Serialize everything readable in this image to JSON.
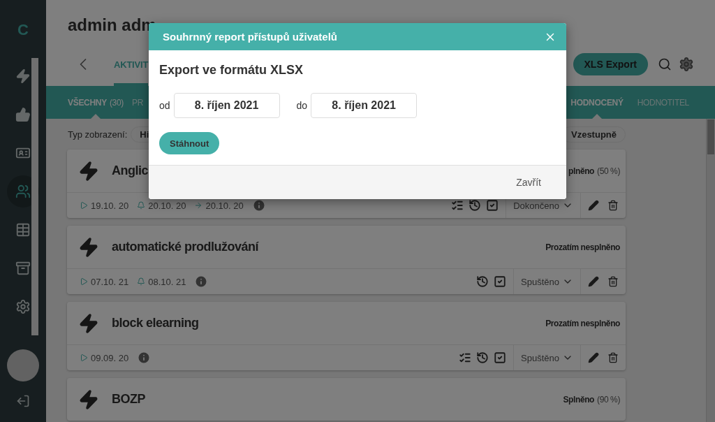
{
  "sidebar": {
    "logo": "C",
    "items": [
      {
        "kind": "bolt",
        "selected": false
      },
      {
        "kind": "thumb",
        "selected": false
      },
      {
        "kind": "card",
        "selected": false
      },
      {
        "kind": "users",
        "selected": true
      },
      {
        "kind": "table",
        "selected": false
      },
      {
        "kind": "archive",
        "selected": false
      },
      {
        "kind": "settings",
        "selected": false
      }
    ]
  },
  "header": {
    "title": "admin adm",
    "tabs": [
      {
        "label": "AKTIVIT",
        "selected": true
      }
    ],
    "export_button": "XLS Export"
  },
  "filter_tabs": [
    {
      "label": "VŠECHNY",
      "count": "(30)",
      "selected": true
    },
    {
      "label": "PR",
      "selected": false
    }
  ],
  "role_tabs": [
    {
      "label": "HODNOCENÝ",
      "selected": true
    },
    {
      "label": "HODNOTITEL",
      "selected": false
    }
  ],
  "view_bar": {
    "label": "Typ zobrazení:",
    "view_chip": "Hi",
    "sort_chip": "Vzestupně"
  },
  "cards": [
    {
      "title": "Anglic",
      "status": "plněno",
      "percent": "(50 %)",
      "footer": {
        "dates": [
          {
            "kind": "start",
            "text": "19.10. 20"
          },
          {
            "kind": "reminder",
            "text": "20.10. 20"
          },
          {
            "kind": "end",
            "text": "20.10. 20"
          }
        ],
        "tools": [
          {
            "kind": "checklist"
          },
          {
            "kind": "history"
          },
          {
            "kind": "check"
          }
        ],
        "state": "Dokončeno"
      }
    },
    {
      "title": "automatické prodlužování",
      "status": "Prozatím nesplněno",
      "footer": {
        "dates": [
          {
            "kind": "start",
            "text": "07.10. 21"
          },
          {
            "kind": "reminder",
            "text": "08.10. 21"
          }
        ],
        "tools": [
          {
            "kind": "history"
          },
          {
            "kind": "check"
          }
        ],
        "state": "Spuštěno"
      }
    },
    {
      "title": "block elearning",
      "status": "Prozatím nesplněno",
      "footer": {
        "dates": [
          {
            "kind": "start",
            "text": "09.09. 20"
          }
        ],
        "tools": [
          {
            "kind": "checklist"
          },
          {
            "kind": "history"
          },
          {
            "kind": "check"
          }
        ],
        "state": "Spuštěno"
      }
    },
    {
      "title": "BOZP",
      "status": "Splněno",
      "percent": "(90 %)"
    }
  ],
  "modal": {
    "title": "Souhrnný report přístupů uživatelů",
    "heading": "Export ve formátu XLSX",
    "from_label": "od",
    "from_value": "8. říjen 2021",
    "to_label": "do",
    "to_value": "8. říjen 2021",
    "download_button": "Stáhnout",
    "close_button": "Zavřít"
  }
}
